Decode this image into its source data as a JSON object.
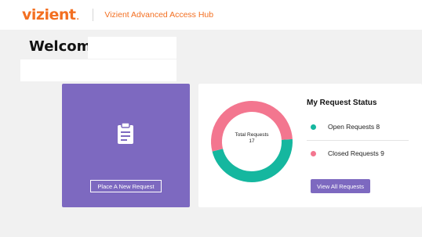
{
  "header": {
    "logo_text": "vizient",
    "logo_dot": ".",
    "app_title": "Vizient Advanced Access Hub"
  },
  "welcome": {
    "greeting": "Welcome,"
  },
  "new_request_tile": {
    "icon": "clipboard-icon",
    "button_label": "Place A New Request"
  },
  "status_card": {
    "title": "My Request Status",
    "total_label": "Total Requests",
    "total_value": "17",
    "open_label": "Open Requests 8",
    "closed_label": "Closed Requests 9",
    "view_all_label": "View All Requests"
  },
  "colors": {
    "brand_orange": "#f36f21",
    "purple": "#7d69c0",
    "teal": "#15b79f",
    "pink": "#f3768f"
  },
  "chart_data": {
    "type": "pie",
    "categories": [
      "Open Requests",
      "Closed Requests"
    ],
    "values": [
      8,
      9
    ],
    "colors": [
      "#15b79f",
      "#f3768f"
    ]
  }
}
